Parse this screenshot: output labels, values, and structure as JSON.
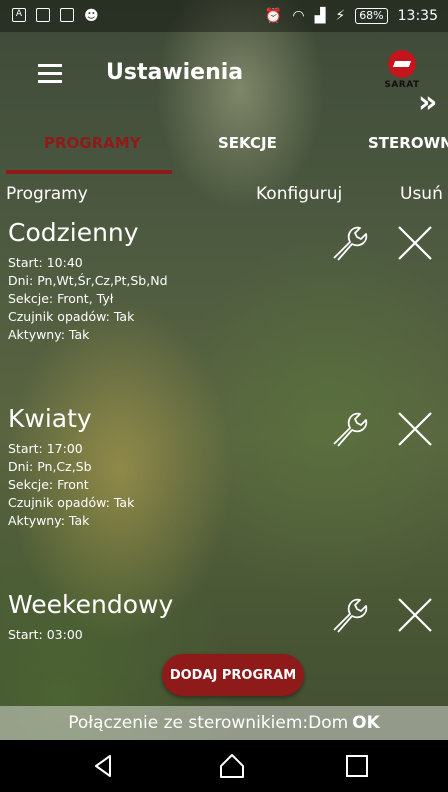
{
  "status_bar": {
    "battery": "68%",
    "time": "13:35"
  },
  "toolbar": {
    "title": "Ustawienia",
    "logo_text": "SARAT"
  },
  "tabs": [
    {
      "label": "PROGRAMY",
      "active": true
    },
    {
      "label": "SEKCJE",
      "active": false
    },
    {
      "label": "STEROWNI",
      "active": false
    }
  ],
  "columns": {
    "programs": "Programy",
    "configure": "Konfiguruj",
    "delete": "Usuń"
  },
  "programs": [
    {
      "name": "Codzienny",
      "start": "Start: 10:40",
      "days": "Dni: Pn,Wt,Śr,Cz,Pt,Sb,Nd",
      "sections": "Sekcje: Front, Tył",
      "rain_sensor": "Czujnik opadów: Tak",
      "active": "Aktywny: Tak"
    },
    {
      "name": "Kwiaty",
      "start": "Start: 17:00",
      "days": "Dni: Pn,Cz,Sb",
      "sections": "Sekcje: Front",
      "rain_sensor": "Czujnik opadów: Tak",
      "active": "Aktywny: Tak"
    },
    {
      "name": "Weekendowy",
      "start": "Start: 03:00"
    }
  ],
  "add_button": "DODAJ PROGRAM",
  "connection": {
    "text": "Połączenie ze sterownikiem:Dom",
    "status": "OK"
  },
  "colors": {
    "accent": "#8f1a1a",
    "brand_red": "#c3151b"
  }
}
